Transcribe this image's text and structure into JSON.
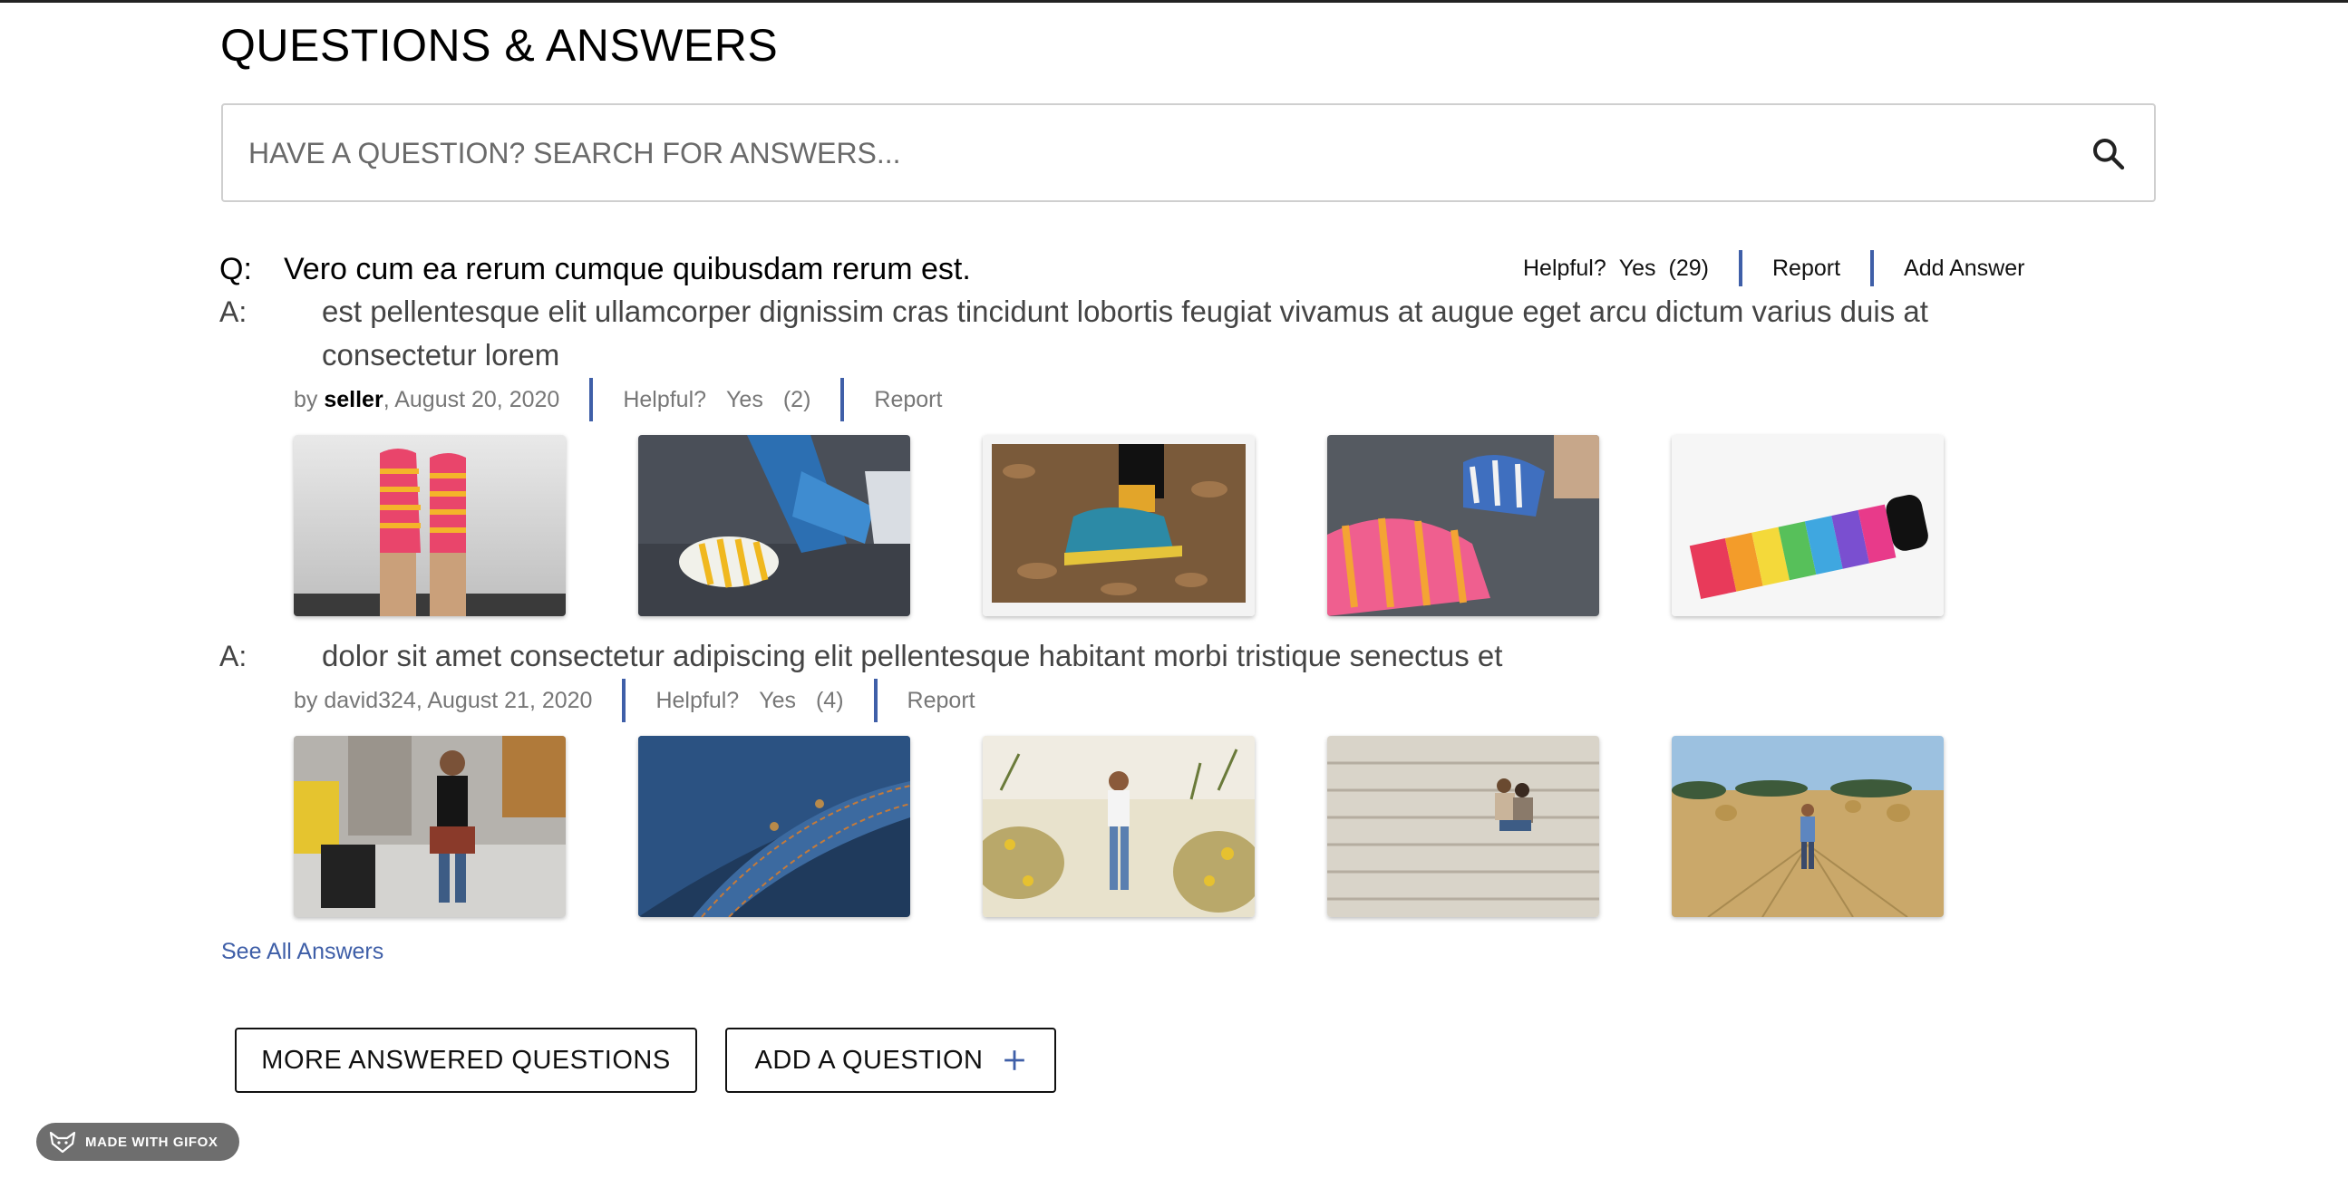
{
  "page": {
    "title": "QUESTIONS & ANSWERS"
  },
  "search": {
    "placeholder": "HAVE A QUESTION? SEARCH FOR ANSWERS..."
  },
  "question": {
    "prefix": "Q:",
    "text": "Vero cum ea rerum cumque quibusdam rerum est.",
    "helpful_label": "Helpful?",
    "yes_label": "Yes",
    "helpful_count": "(29)",
    "report_label": "Report",
    "add_answer_label": "Add Answer"
  },
  "answers": [
    {
      "prefix": "A:",
      "body": "est pellentesque elit ullamcorper dignissim cras tincidunt lobortis feugiat vivamus at augue eget arcu dictum varius duis at consectetur lorem",
      "by_label": "by",
      "author": "seller",
      "date": ", August 20, 2020",
      "helpful_label": "Helpful?",
      "yes_label": "Yes",
      "helpful_count": "(2)",
      "report_label": "Report",
      "photos": [
        "striped-socks-legs-photo",
        "yellow-white-socks-couch-photo",
        "sneakers-leaves-photo",
        "colorful-knit-socks-photo",
        "rainbow-striped-socks-photo"
      ]
    },
    {
      "prefix": "A:",
      "body": "dolor sit amet consectetur adipiscing elit pellentesque habitant morbi tristique senectus et",
      "by_label": "by",
      "author": "david324",
      "date": ", August 21, 2020",
      "helpful_label": "Helpful?",
      "yes_label": "Yes",
      "helpful_count": "(4)",
      "report_label": "Report",
      "photos": [
        "man-street-sunglasses-photo",
        "denim-jeans-closeup-photo",
        "woman-desert-walk-photo",
        "couple-stone-steps-photo",
        "man-hay-field-photo"
      ]
    }
  ],
  "see_all_label": "See All Answers",
  "buttons": {
    "more_questions": "MORE ANSWERED QUESTIONS",
    "add_question": "ADD A QUESTION"
  },
  "badge": {
    "text": "MADE WITH GIFOX"
  },
  "colors": {
    "accent": "#3f5fa8",
    "text_muted": "#777777",
    "border": "#cfcfcf"
  }
}
